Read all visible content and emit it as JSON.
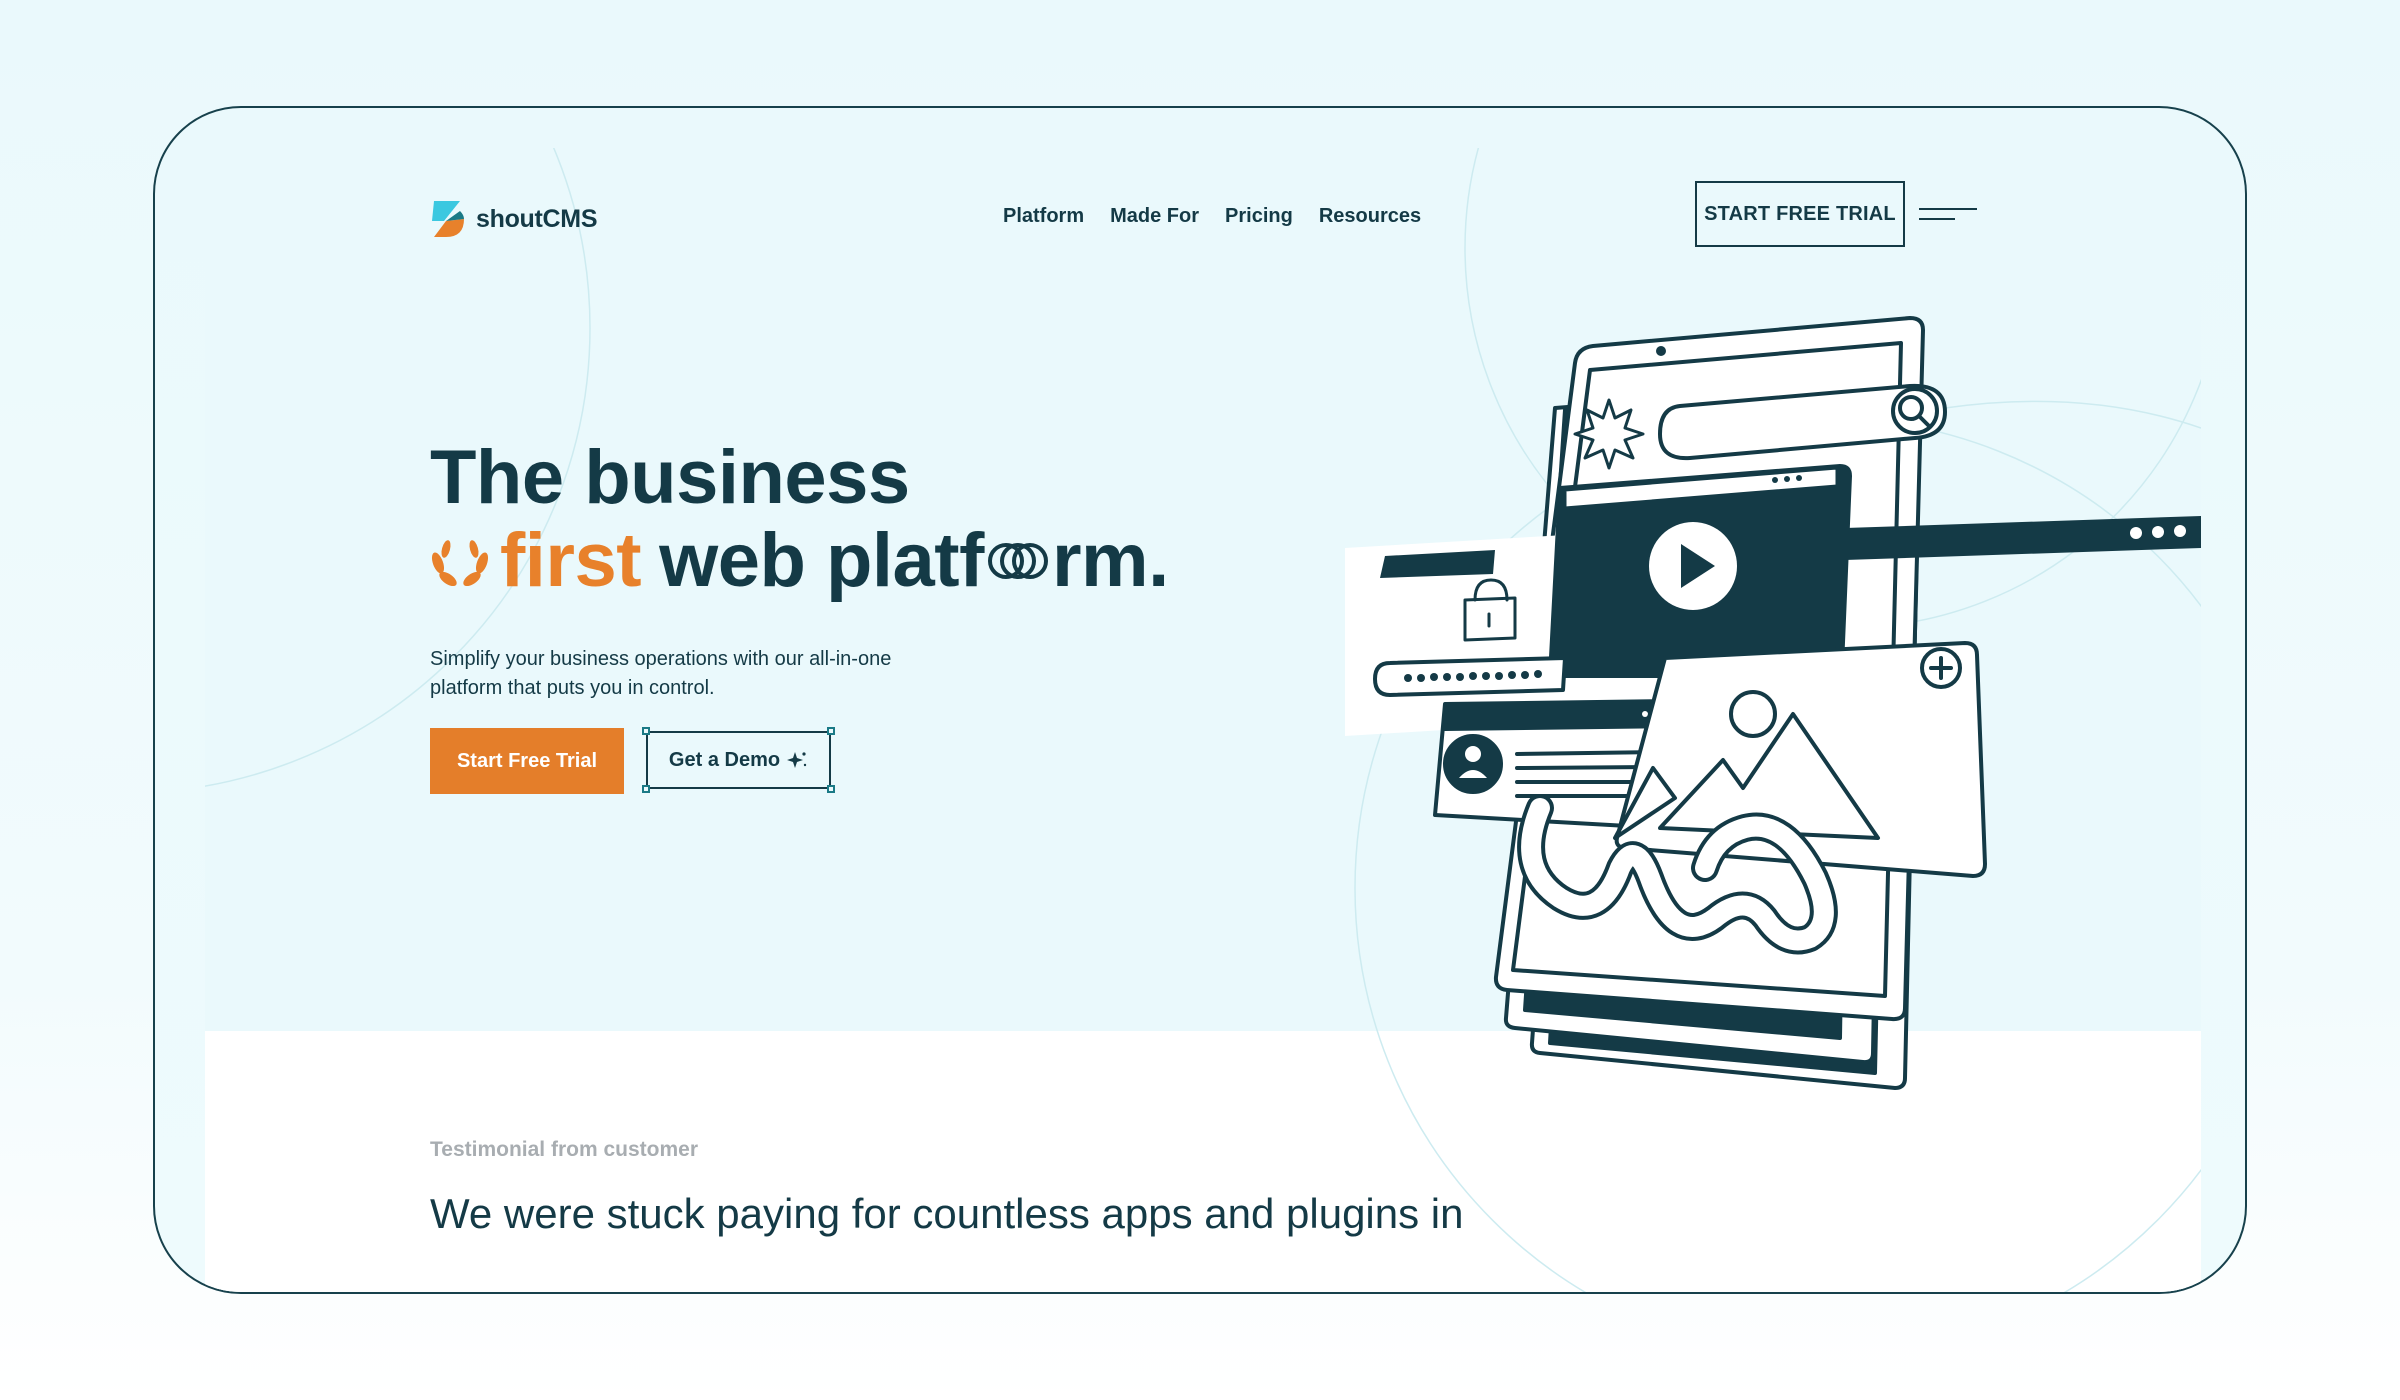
{
  "brand": {
    "name": "shoutCMS",
    "orange": "#e8812b",
    "dark": "#143a46",
    "teal": "#3bc8e0"
  },
  "nav": {
    "items": [
      "Platform",
      "Made For",
      "Pricing",
      "Resources"
    ]
  },
  "header": {
    "cta": "START FREE TRIAL",
    "menu_icon": "hamburger-icon"
  },
  "hero": {
    "line1": "The business",
    "accent": "first",
    "line2_a": "web platf",
    "line2_b": "rm.",
    "subtitle": "Simplify your business operations with our all-in-one platform that puts you in control.",
    "primary_button": "Start Free Trial",
    "secondary_button": "Get a Demo"
  },
  "testimonial": {
    "label": "Testimonial from customer",
    "quote": "We were stuck paying for countless apps and plugins in"
  }
}
